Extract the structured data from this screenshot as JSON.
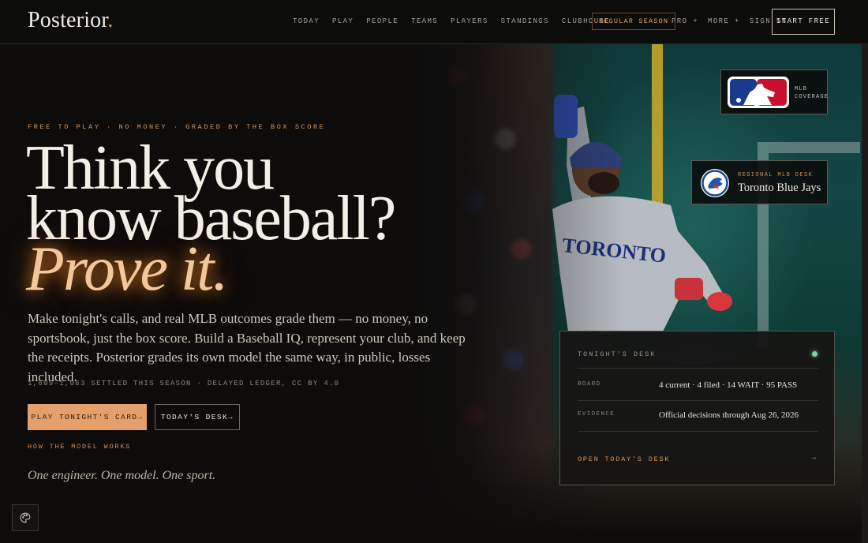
{
  "header": {
    "logo": "Posterior",
    "logo_dot": ".",
    "nav": [
      "TODAY",
      "PLAY",
      "PEOPLE",
      "TEAMS",
      "PLAYERS",
      "STANDINGS",
      "CLUBHOUSE"
    ],
    "season_button": "REGULAR SEASON",
    "pro_link": "PRO +",
    "more_link": "MORE +",
    "sign_in": "SIGN IN",
    "start_button": "START FREE"
  },
  "hero": {
    "eyebrow": "FREE TO PLAY · NO MONEY · GRADED BY THE BOX SCORE",
    "headline_line1": "Think you",
    "headline_line2": "know baseball?",
    "headline_line3": "Prove it.",
    "lede": "Make tonight's calls, and real MLB outcomes grade them — no money, no sportsbook, just the box score. Build a Baseball IQ, represent your club, and keep the receipts. Posterior grades its own model the same way, in public, losses included.",
    "ledger": "1,609–1,063 SETTLED THIS SEASON · DELAYED LEDGER, CC BY 4.0",
    "play_button": "PLAY TONIGHT'S CARD→",
    "desk_button": "TODAY'S DESK→",
    "how_link": "HOW THE MODEL WORKS",
    "tagline": "One engineer. One model. One sport."
  },
  "mlb_card": {
    "label_line1": "MLB",
    "label_line2": "COVERAGE"
  },
  "team_card": {
    "subtitle": "REGIONAL MLB DESK",
    "team": "Toronto Blue Jays"
  },
  "desk_card": {
    "title": "TONIGHT'S DESK",
    "board_key": "BOARD",
    "board_value": "4 current · 4 filed · 14 WAIT · 95 PASS",
    "evidence_key": "EVIDENCE",
    "evidence_value": "Official decisions through Aug 26, 2026",
    "open_link": "OPEN TODAY'S DESK",
    "arrow": "→"
  },
  "icons": {
    "palette": "palette-icon",
    "status": "live-status-dot-icon",
    "mlb": "mlb-logo-icon",
    "team": "blue-jays-logo-icon"
  },
  "colors": {
    "accent": "#e3a06a",
    "background": "#0d0c0b",
    "status_live": "#7fd6a4"
  }
}
